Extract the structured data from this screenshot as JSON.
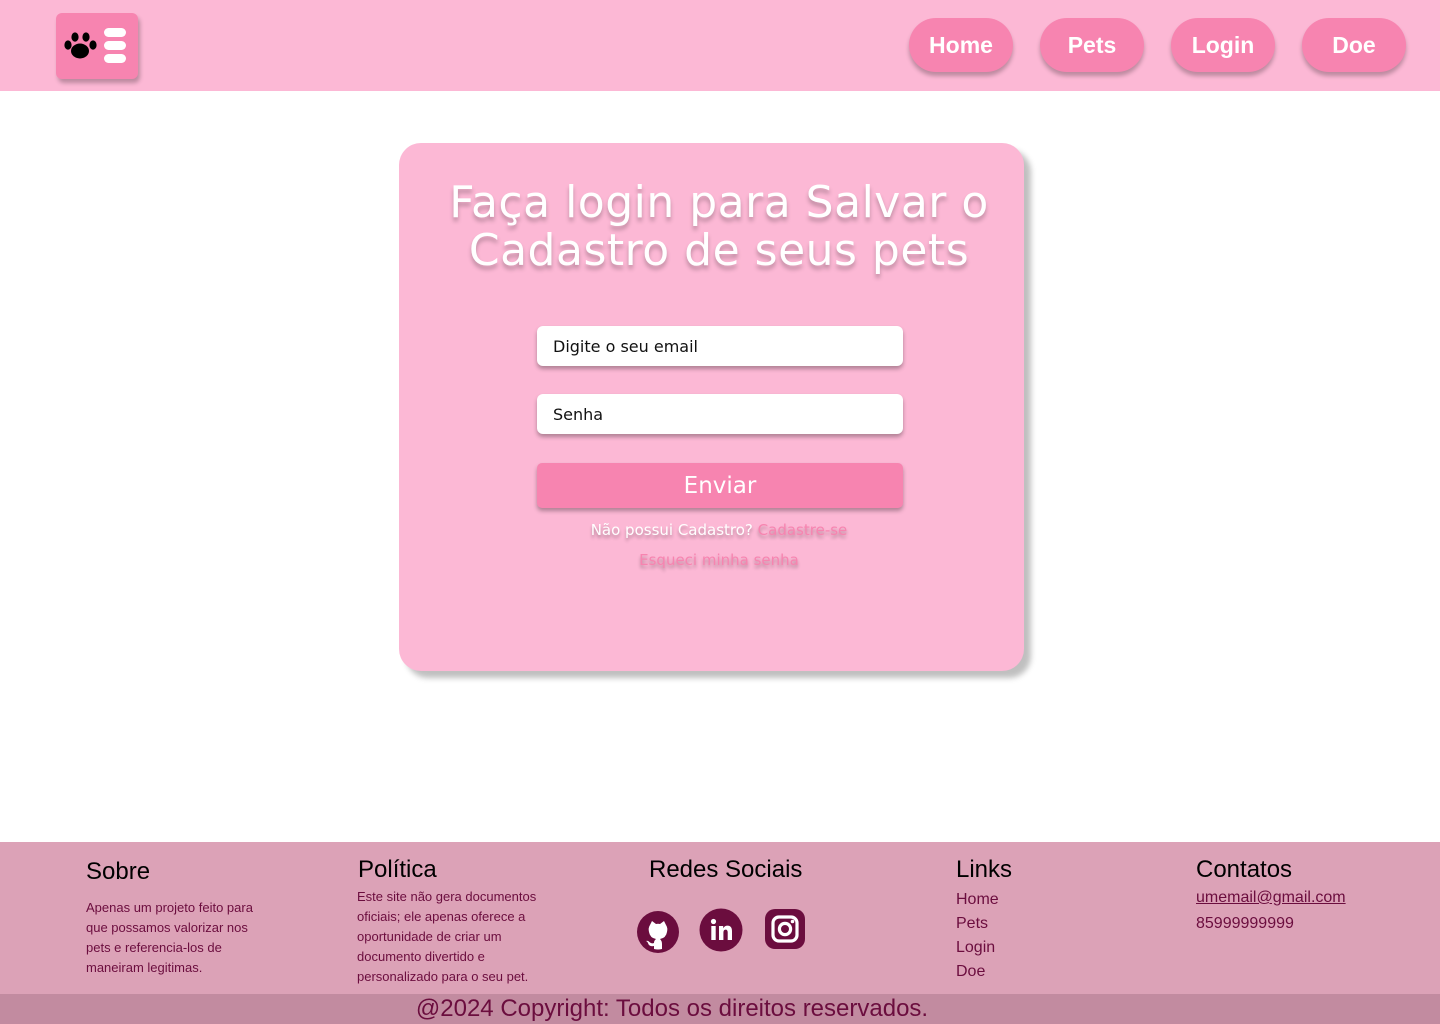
{
  "colors": {
    "header_bg": "#fcb8d5",
    "accent": "#f784b0",
    "footer_bg": "#dca2b7",
    "copyright_bg": "#c28ba0",
    "footer_text": "#6b0d3e"
  },
  "header": {
    "logo_icon": "paw-menu-icon",
    "nav": [
      {
        "label": "Home"
      },
      {
        "label": "Pets"
      },
      {
        "label": "Login"
      },
      {
        "label": "Doe"
      }
    ]
  },
  "login": {
    "title_line1": "Faça login para Salvar o",
    "title_line2": "Cadastro de seus pets",
    "email_placeholder": "Digite o seu email",
    "password_placeholder": "Senha",
    "submit_label": "Enviar",
    "no_account_text": "Não possui Cadastro?",
    "signup_link": "Cadastre-se",
    "forgot_link": "Esqueci minha senha"
  },
  "footer": {
    "about": {
      "heading": "Sobre",
      "lines": [
        "Apenas um projeto feito para",
        "que possamos valorizar nos",
        "pets e referencia-los de",
        "maneiram legitimas."
      ]
    },
    "policy": {
      "heading": "Política",
      "lines": [
        "Este site não gera documentos",
        "oficiais; ele apenas oferece a",
        "oportunidade de criar um",
        "documento divertido e",
        "personalizado para o seu pet."
      ]
    },
    "social": {
      "heading": "Redes Sociais",
      "icons": [
        "github-icon",
        "linkedin-icon",
        "instagram-icon"
      ]
    },
    "links": {
      "heading": "Links",
      "items": [
        "Home",
        "Pets",
        "Login",
        "Doe"
      ]
    },
    "contacts": {
      "heading": "Contatos",
      "email": "umemail@gmail.com",
      "phone": "85999999999"
    },
    "copyright": "@2024 Copyright: Todos os direitos reservados."
  }
}
